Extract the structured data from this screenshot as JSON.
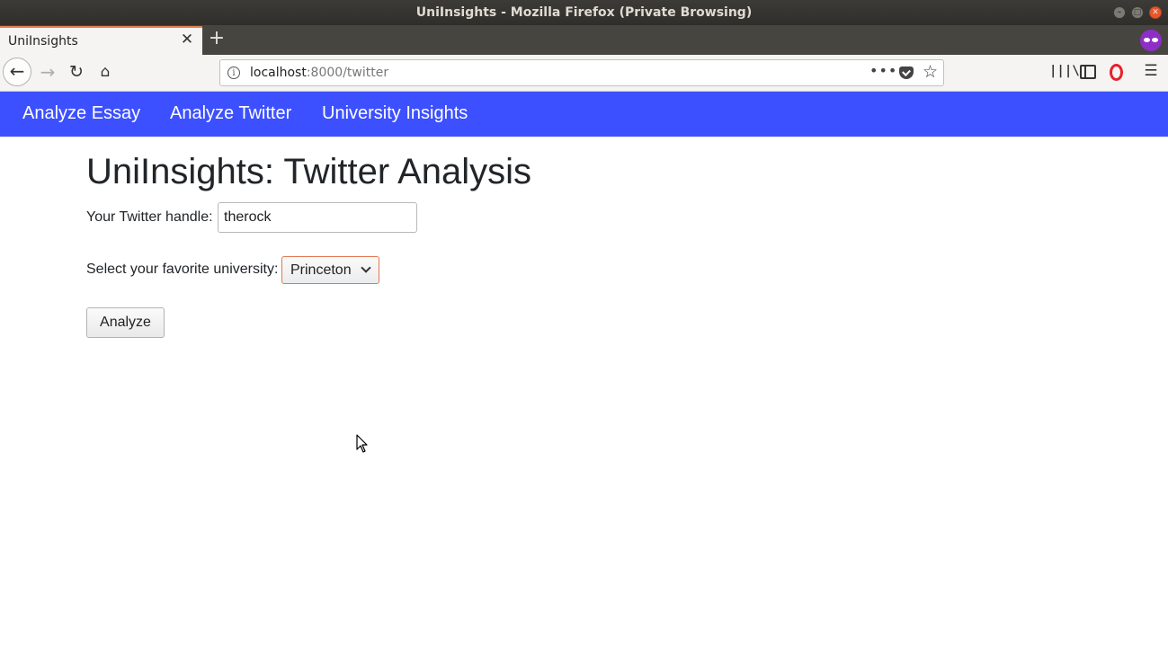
{
  "window": {
    "title": "UniInsights - Mozilla Firefox (Private Browsing)"
  },
  "tabs": [
    {
      "label": "UniInsights"
    }
  ],
  "urlbar": {
    "host": "localhost",
    "path": ":8000/twitter"
  },
  "app_nav": {
    "items": [
      {
        "label": "Analyze Essay"
      },
      {
        "label": "Analyze Twitter"
      },
      {
        "label": "University Insights"
      }
    ],
    "background": "#3d50ff"
  },
  "main": {
    "heading": "UniInsights: Twitter Analysis",
    "handle_label": "Your Twitter handle:",
    "handle_value": "therock",
    "university_label": "Select your favorite university:",
    "university_selected": "Princeton",
    "analyze_label": "Analyze"
  },
  "colors": {
    "tab_accent": "#e8804a",
    "privacy_badge": "#8d2fc7",
    "select_border": "#e07850"
  },
  "icons": {
    "back": "back-arrow-icon",
    "forward": "forward-arrow-icon",
    "reload": "reload-icon",
    "home": "home-icon",
    "info": "info-icon",
    "page_actions": "more-dots-icon",
    "pocket": "pocket-icon",
    "bookmark": "star-icon",
    "library": "library-icon",
    "sidebar": "sidebar-icon",
    "opera": "opera-icon",
    "menu": "hamburger-menu-icon",
    "private": "private-browsing-icon",
    "dropdown": "chevron-down-icon"
  }
}
